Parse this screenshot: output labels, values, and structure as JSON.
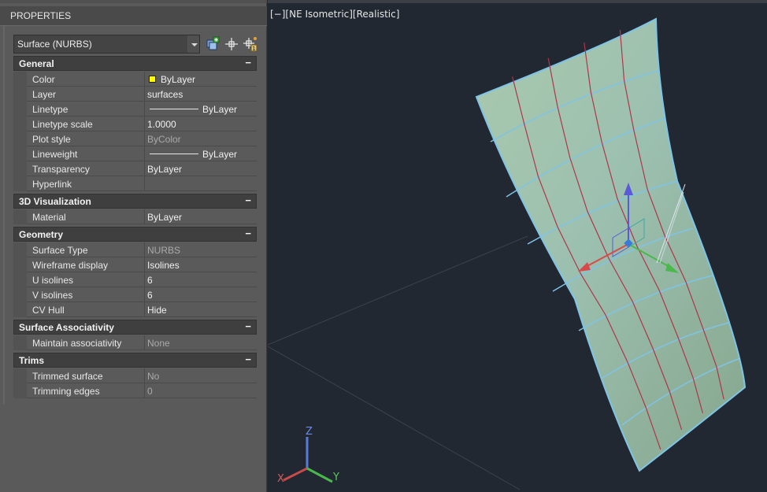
{
  "palette": {
    "title": "PROPERTIES",
    "object_type": "Surface (NURBS)"
  },
  "categories": {
    "general": {
      "name": "General",
      "collapse": "−",
      "props": [
        {
          "name": "Color",
          "value": "ByLayer"
        },
        {
          "name": "Layer",
          "value": "surfaces"
        },
        {
          "name": "Linetype",
          "value": "ByLayer"
        },
        {
          "name": "Linetype scale",
          "value": "1.0000"
        },
        {
          "name": "Plot style",
          "value": "ByColor"
        },
        {
          "name": "Lineweight",
          "value": "ByLayer"
        },
        {
          "name": "Transparency",
          "value": "ByLayer"
        },
        {
          "name": "Hyperlink",
          "value": ""
        }
      ]
    },
    "visualization": {
      "name": "3D Visualization",
      "collapse": "−",
      "props": [
        {
          "name": "Material",
          "value": "ByLayer"
        }
      ]
    },
    "geometry": {
      "name": "Geometry",
      "collapse": "−",
      "props": [
        {
          "name": "Surface Type",
          "value": "NURBS"
        },
        {
          "name": "Wireframe display",
          "value": "Isolines"
        },
        {
          "name": "U isolines",
          "value": "6"
        },
        {
          "name": "V isolines",
          "value": "6"
        },
        {
          "name": "CV Hull",
          "value": "Hide"
        }
      ]
    },
    "associativity": {
      "name": "Surface Associativity",
      "collapse": "−",
      "props": [
        {
          "name": "Maintain associativity",
          "value": "None"
        }
      ]
    },
    "trims": {
      "name": "Trims",
      "collapse": "−",
      "props": [
        {
          "name": "Trimmed surface",
          "value": "No"
        },
        {
          "name": "Trimming edges",
          "value": "0"
        }
      ]
    }
  },
  "viewport": {
    "label": "[−][NE Isometric][Realistic]",
    "ucs": {
      "x": "X",
      "y": "Y",
      "z": "Z"
    }
  },
  "colors": {
    "color_swatch": "#ffff00",
    "surface_fill": "#9fc0a6",
    "surface_edge": "#7fc4e6",
    "isoline": "#b0354a",
    "gizmo_z": "#5a5ad8",
    "gizmo_x": "#d84a4a",
    "gizmo_y": "#4ab84a"
  },
  "icons": {
    "quick_select": "quick-select-icon",
    "pick_objects": "pick-objects-icon",
    "toggle_pickadd": "toggle-pickadd-icon"
  }
}
